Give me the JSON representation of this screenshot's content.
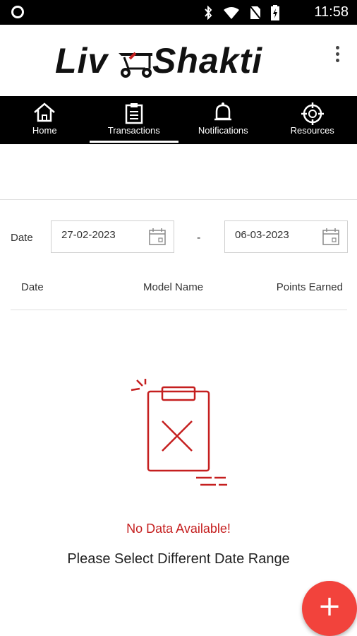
{
  "status_bar": {
    "time": "11:58",
    "icons": [
      "notification-dot-icon",
      "bluetooth-icon",
      "wifi-icon",
      "no-sim-icon",
      "battery-charging-icon"
    ]
  },
  "header": {
    "logo_left": "Liv",
    "logo_right": "Shakti",
    "menu_icon": "more-vertical-icon"
  },
  "nav": {
    "items": [
      {
        "label": "Home",
        "icon": "home-icon"
      },
      {
        "label": "Transactions",
        "icon": "clipboard-icon",
        "active": true
      },
      {
        "label": "Notifications",
        "icon": "bell-icon"
      },
      {
        "label": "Resources",
        "icon": "crosshair-icon"
      }
    ]
  },
  "filter": {
    "label": "Date",
    "from": "27-02-2023",
    "separator": "-",
    "to": "06-03-2023"
  },
  "table": {
    "columns": [
      "Date",
      "Model Name",
      "Points Earned"
    ]
  },
  "empty_state": {
    "title": "No Data Available!",
    "subtitle": "Please Select Different Date Range"
  },
  "fab": {
    "label": "+"
  },
  "colors": {
    "accent": "#c51f1f",
    "fab": "#f2433c",
    "bar": "#000000"
  }
}
